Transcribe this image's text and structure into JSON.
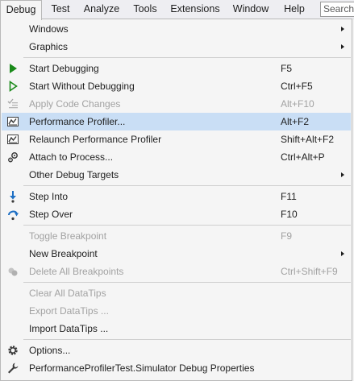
{
  "menubar": {
    "items": [
      "Debug",
      "Test",
      "Analyze",
      "Tools",
      "Extensions",
      "Window",
      "Help"
    ],
    "search_placeholder": "Search"
  },
  "menu": {
    "items": [
      {
        "label": "Windows",
        "shortcut": "",
        "submenu": true
      },
      {
        "label": "Graphics",
        "shortcut": "",
        "submenu": true
      },
      {
        "label": "Start Debugging",
        "shortcut": "F5",
        "icon": "play-icon"
      },
      {
        "label": "Start Without Debugging",
        "shortcut": "Ctrl+F5",
        "icon": "play-outline-icon"
      },
      {
        "label": "Apply Code Changes",
        "shortcut": "Alt+F10",
        "icon": "code-changes-icon",
        "disabled": true
      },
      {
        "label": "Performance Profiler...",
        "shortcut": "Alt+F2",
        "icon": "profiler-icon",
        "highlighted": true
      },
      {
        "label": "Relaunch Performance Profiler",
        "shortcut": "Shift+Alt+F2",
        "icon": "profiler-icon"
      },
      {
        "label": "Attach to Process...",
        "shortcut": "Ctrl+Alt+P",
        "icon": "attach-icon"
      },
      {
        "label": "Other Debug Targets",
        "shortcut": "",
        "submenu": true
      },
      {
        "label": "Step Into",
        "shortcut": "F11",
        "icon": "step-into-icon"
      },
      {
        "label": "Step Over",
        "shortcut": "F10",
        "icon": "step-over-icon"
      },
      {
        "label": "Toggle Breakpoint",
        "shortcut": "F9",
        "disabled": true
      },
      {
        "label": "New Breakpoint",
        "shortcut": "",
        "submenu": true
      },
      {
        "label": "Delete All Breakpoints",
        "shortcut": "Ctrl+Shift+F9",
        "icon": "delete-breakpoints-icon",
        "disabled": true
      },
      {
        "label": "Clear All DataTips",
        "shortcut": "",
        "disabled": true
      },
      {
        "label": "Export DataTips ...",
        "shortcut": "",
        "disabled": true
      },
      {
        "label": "Import DataTips ...",
        "shortcut": ""
      },
      {
        "label": "Options...",
        "shortcut": "",
        "icon": "gear-icon"
      },
      {
        "label": "PerformanceProfilerTest.Simulator Debug Properties",
        "shortcut": "",
        "icon": "wrench-icon"
      }
    ]
  },
  "colors": {
    "highlight": "#c9def5",
    "menu_background": "#f5f5f5",
    "disabled_text": "#a2a2a2",
    "play_green": "#1a8a1a",
    "step_blue": "#1e6fc4"
  }
}
